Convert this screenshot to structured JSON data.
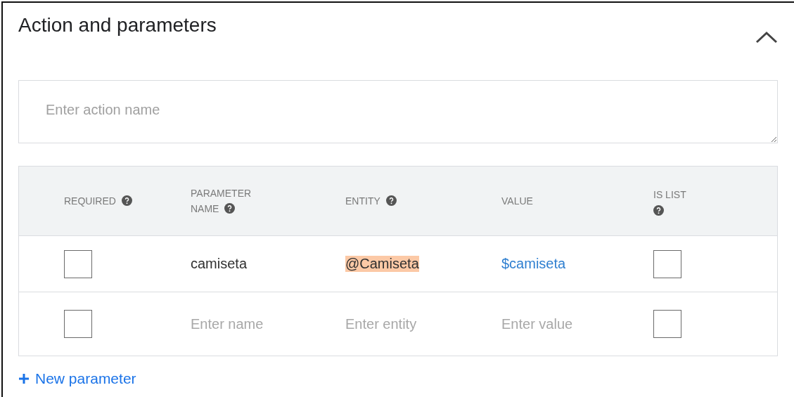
{
  "panel": {
    "title": "Action and parameters",
    "expanded": true
  },
  "action_field": {
    "placeholder": "Enter action name"
  },
  "table": {
    "columns": [
      {
        "label": "REQUIRED",
        "help": true
      },
      {
        "label": "PARAMETER NAME",
        "help": true
      },
      {
        "label": "ENTITY",
        "help": true
      },
      {
        "label": "VALUE",
        "help": false
      },
      {
        "label": "IS LIST",
        "help": true
      }
    ],
    "rows": [
      {
        "required": {
          "checked": false
        },
        "name": {
          "value": "camiseta"
        },
        "entity": {
          "value": "@Camiseta",
          "highlighted": true
        },
        "value": {
          "value": "$camiseta"
        },
        "is_list": {
          "checked": false
        }
      },
      {
        "required": {
          "checked": false
        },
        "name": {
          "placeholder": "Enter name"
        },
        "entity": {
          "placeholder": "Enter entity",
          "highlighted": false
        },
        "value": {
          "placeholder": "Enter value"
        },
        "is_list": {
          "checked": false
        }
      }
    ]
  },
  "new_parameter_link": {
    "label": "New parameter"
  }
}
